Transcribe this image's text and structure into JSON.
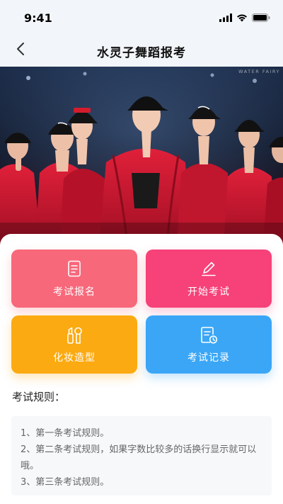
{
  "status_bar": {
    "time": "9:41",
    "icons": [
      "signal-icon",
      "wifi-icon",
      "battery-icon"
    ]
  },
  "nav": {
    "back_icon": "chevron-left-icon",
    "title": "水灵子舞蹈报考"
  },
  "banner": {
    "watermark": "WATER FAIRY D"
  },
  "actions": [
    {
      "label": "考试报名",
      "icon": "document-icon",
      "color": "#f7687a"
    },
    {
      "label": "开始考试",
      "icon": "pen-icon",
      "color": "#f64179"
    },
    {
      "label": "化妆造型",
      "icon": "makeup-icon",
      "color": "#fcaa12"
    },
    {
      "label": "考试记录",
      "icon": "record-clock-icon",
      "color": "#3ba6f5"
    }
  ],
  "rules": {
    "heading": "考试规则：",
    "items": [
      "1、第一条考试规则。",
      "2、第二条考试规则，如果字数比较多的话换行显示就可以哦。",
      "3、第三条考试规则。"
    ]
  }
}
